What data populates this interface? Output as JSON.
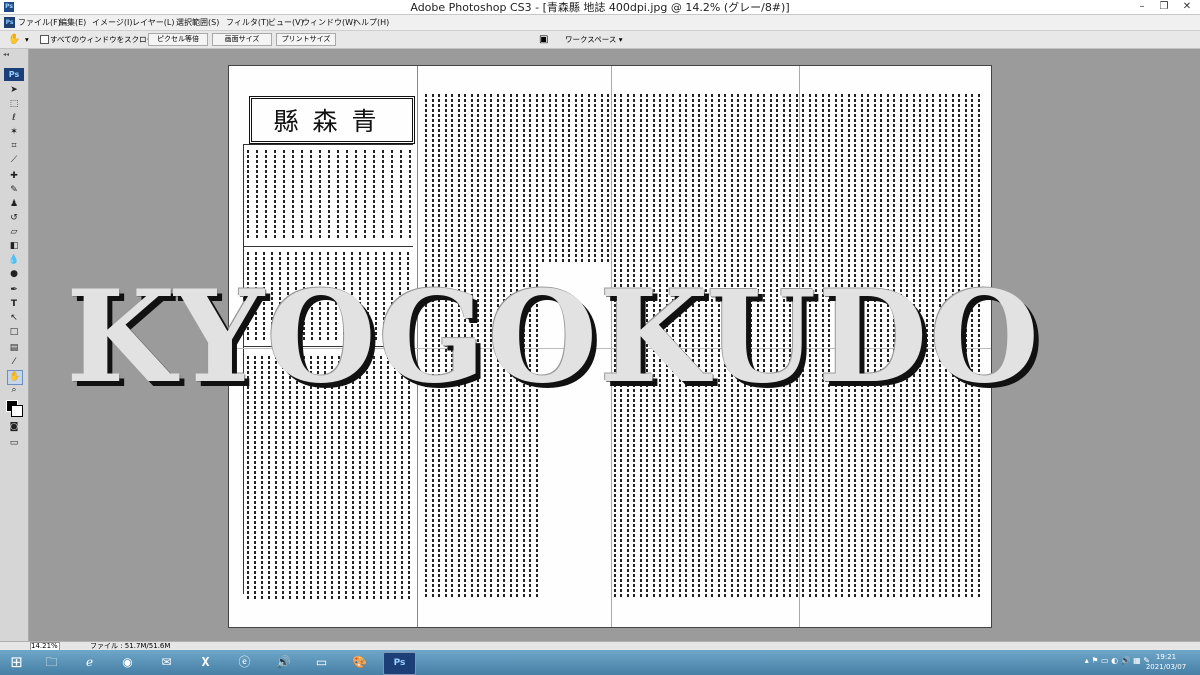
{
  "window": {
    "title": "Adobe Photoshop CS3 - [青森縣 地誌 400dpi.jpg @ 14.2% (グレー/8#)]",
    "app_icon": "Ps",
    "minimize": "–",
    "restore": "❐",
    "close": "✕"
  },
  "menu": {
    "items": [
      "ファイル(F)",
      "編集(E)",
      "イメージ(I)",
      "レイヤー(L)",
      "選択範囲(S)",
      "フィルタ(T)",
      "ビュー(V)",
      "ウィンドウ(W)",
      "ヘルプ(H)"
    ]
  },
  "options_bar": {
    "scroll_all_label": "すべてのウィンドウをスクロール",
    "actual_pixels": "ピクセル等倍",
    "fit_screen": "画面サイズ",
    "print_size": "プリントサイズ",
    "workspace": "ワークスペース ▾"
  },
  "tools": {
    "logo": "Ps",
    "items": [
      "move-tool",
      "marquee-tool",
      "lasso-tool",
      "magic-wand-tool",
      "crop-tool",
      "slice-tool",
      "healing-brush-tool",
      "brush-tool",
      "clone-stamp-tool",
      "history-brush-tool",
      "eraser-tool",
      "gradient-tool",
      "blur-tool",
      "dodge-tool",
      "pen-tool",
      "type-tool",
      "path-selection-tool",
      "shape-tool",
      "notes-tool",
      "eyedropper-tool",
      "hand-tool",
      "zoom-tool",
      "color-swatches",
      "quick-mask-mode",
      "screen-mode"
    ]
  },
  "document": {
    "masthead": "縣森青",
    "watermark": "KYOGOKUDO"
  },
  "status": {
    "zoom": "14.21%",
    "file_size": "ファイル : 51.7M/51.6M"
  },
  "taskbar": {
    "clock_time": "19:21",
    "clock_date": "2021/03/07"
  }
}
